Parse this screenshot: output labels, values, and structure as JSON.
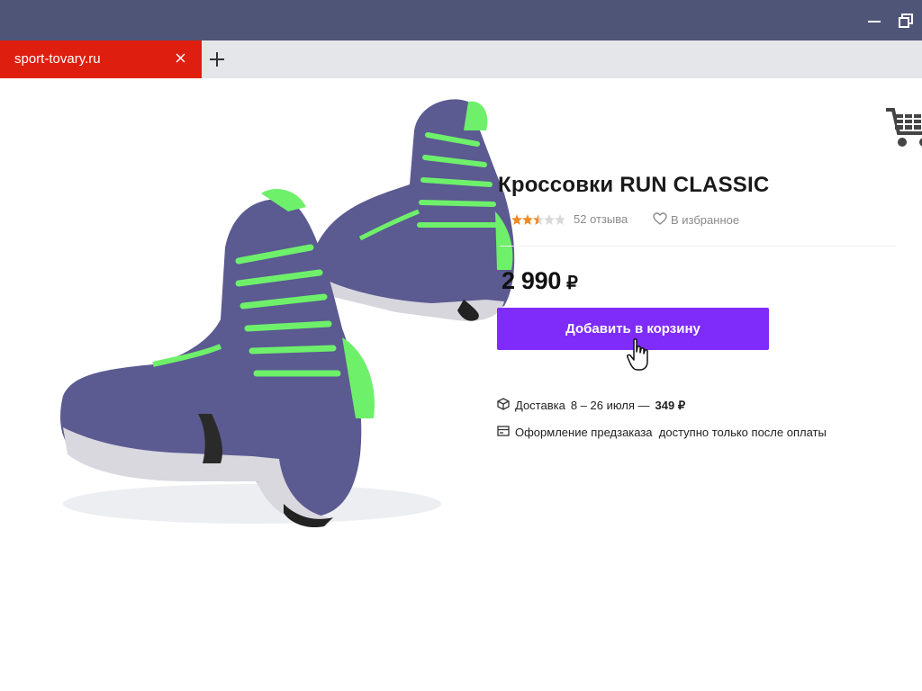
{
  "browser": {
    "tab_title": "sport-tovary.ru",
    "close_tab_icon": "close-icon",
    "new_tab_icon": "plus-icon",
    "minimize_icon": "minimize-icon",
    "restore_icon": "restore-icon"
  },
  "product": {
    "title": "Кроссовки RUN CLASSIC",
    "rating": 2.5,
    "rating_max": 5,
    "reviews": "52 отзыва",
    "favorite_label": "В избранное",
    "price": "2 990",
    "currency": "₽",
    "add_to_cart": "Добавить в корзину"
  },
  "delivery": {
    "label": "Доставка",
    "dates": "8 – 26 июля —",
    "price": "349 ₽"
  },
  "preorder": {
    "text": "Оформление предзаказа  доступно только после оплаты"
  },
  "colors": {
    "accent": "#7f2cfa",
    "tab_active": "#de1f10",
    "titlebar": "#4f5577",
    "star": "#f08a24"
  },
  "icons": {
    "cart": "shopping-cart-icon",
    "heart": "heart-icon",
    "delivery": "box-icon",
    "preorder": "card-icon",
    "cursor": "hand-cursor-icon"
  }
}
